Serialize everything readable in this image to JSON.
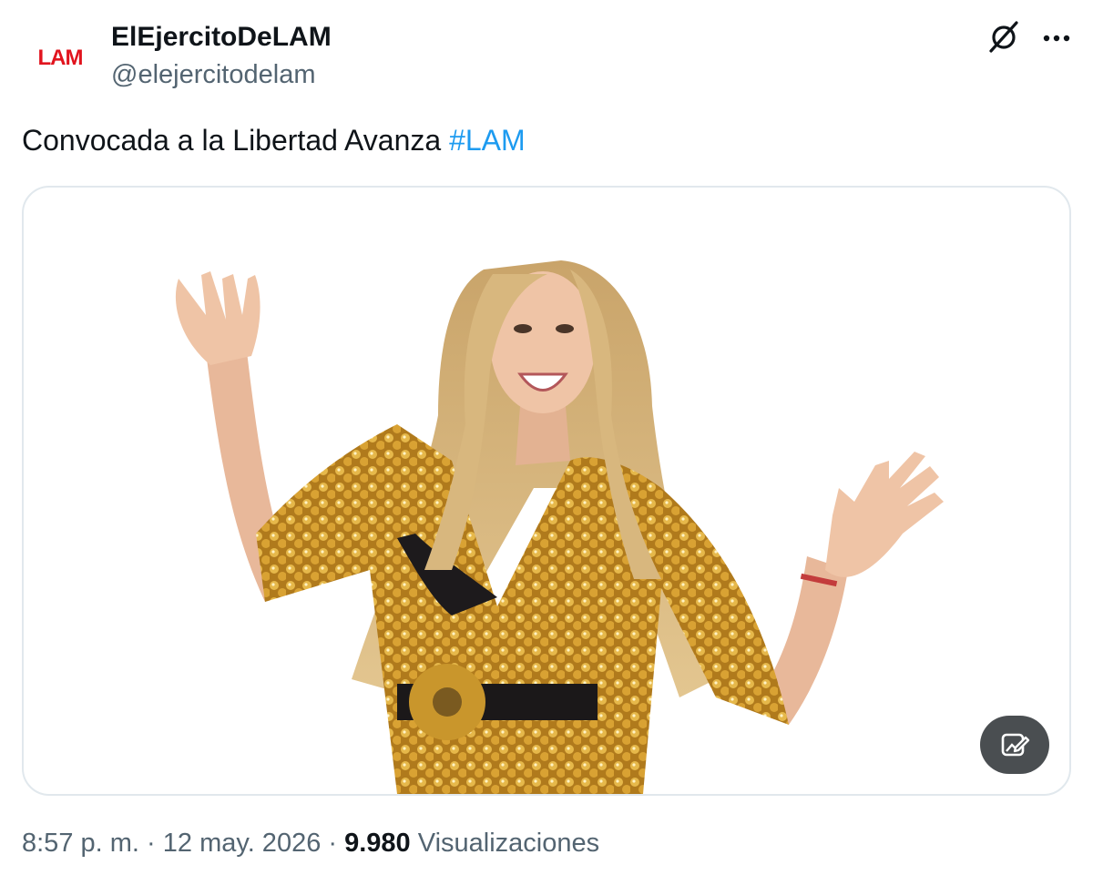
{
  "author": {
    "display_name": "ElEjercitoDeLAM",
    "handle": "@elejercitodelam",
    "avatar_text": "LAM",
    "avatar_color": "#e1141e"
  },
  "tweet": {
    "text": "Convocada a la Libertad Avanza ",
    "hashtag": "#LAM"
  },
  "header_icons": {
    "grok": "grok-slash-icon",
    "more": "more-dots-icon"
  },
  "media": {
    "description_button_icon": "image-edit-icon"
  },
  "meta": {
    "time": "8:57 p. m.",
    "separator": " · ",
    "date": "12 may. 2026",
    "views_count": "9.980",
    "views_label": " Visualizaciones"
  },
  "colors": {
    "accent": "#1d9bf0",
    "text": "#0f1419",
    "secondary": "#536471",
    "gold": "#c8962a"
  }
}
